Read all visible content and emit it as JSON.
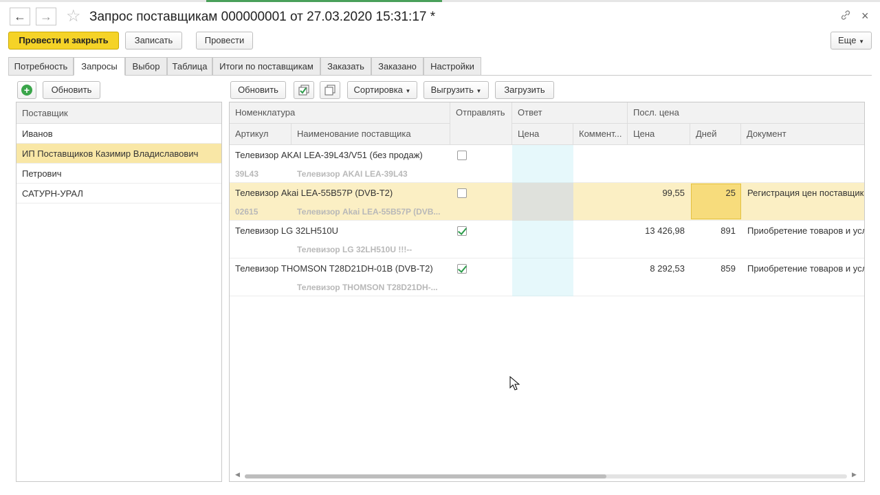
{
  "window": {
    "title": "Запрос поставщикам 000000001 от 27.03.2020 15:31:17 *",
    "back_icon": "←",
    "forward_icon": "→",
    "star_icon": "☆",
    "link_icon": "🔗",
    "close_icon": "×"
  },
  "toolbar": {
    "post_close": "Провести и закрыть",
    "save": "Записать",
    "post": "Провести",
    "more": "Еще"
  },
  "tabs": [
    "Потребность",
    "Запросы",
    "Выбор",
    "Таблица",
    "Итоги по поставщикам",
    "Заказать",
    "Заказано",
    "Настройки"
  ],
  "left": {
    "refresh": "Обновить",
    "add_icon": "+",
    "column": "Поставщик",
    "suppliers": [
      "Иванов",
      "ИП Поставщиков Казимир Владиславович",
      "Петрович",
      "САТУРН-УРАЛ"
    ]
  },
  "right_toolbar": {
    "refresh": "Обновить",
    "sort": "Сортировка",
    "export": "Выгрузить",
    "import": "Загрузить"
  },
  "table": {
    "headers": {
      "nomenclature": "Номенклатура",
      "send": "Отправлять",
      "answer": "Ответ",
      "last_price": "Посл. цена",
      "article": "Артикул",
      "supplier_name": "Наименование поставщика",
      "price": "Цена",
      "comment": "Коммент...",
      "lp_price": "Цена",
      "days": "Дней",
      "document": "Документ"
    },
    "rows": [
      {
        "name": "Телевизор AKAI LEA-39L43/V51 (без продаж)",
        "article": "39L43",
        "supplier_name": "Телевизор AKAI LEA-39L43",
        "send": false,
        "price": "",
        "days": "",
        "document": ""
      },
      {
        "name": "Телевизор Akai LEA-55B57P (DVB-T2)",
        "article": "02615",
        "supplier_name": "Телевизор Akai LEA-55B57P (DVB...",
        "send": false,
        "price": "99,55",
        "days": "25",
        "document": "Регистрация цен поставщика"
      },
      {
        "name": "Телевизор LG 32LH510U",
        "article": "",
        "supplier_name": "Телевизор LG 32LH510U !!!--",
        "send": true,
        "price": "13 426,98",
        "days": "891",
        "document": "Приобретение товаров и услуг"
      },
      {
        "name": "Телевизор THOMSON T28D21DH-01B (DVB-T2)",
        "article": "",
        "supplier_name": "Телевизор THOMSON T28D21DH-...",
        "send": true,
        "price": "8 292,53",
        "days": "859",
        "document": "Приобретение товаров и услуг"
      }
    ]
  },
  "colors": {
    "primary": "#f5d327",
    "selection": "#f9e7a6",
    "check": "#2c9c4b"
  }
}
